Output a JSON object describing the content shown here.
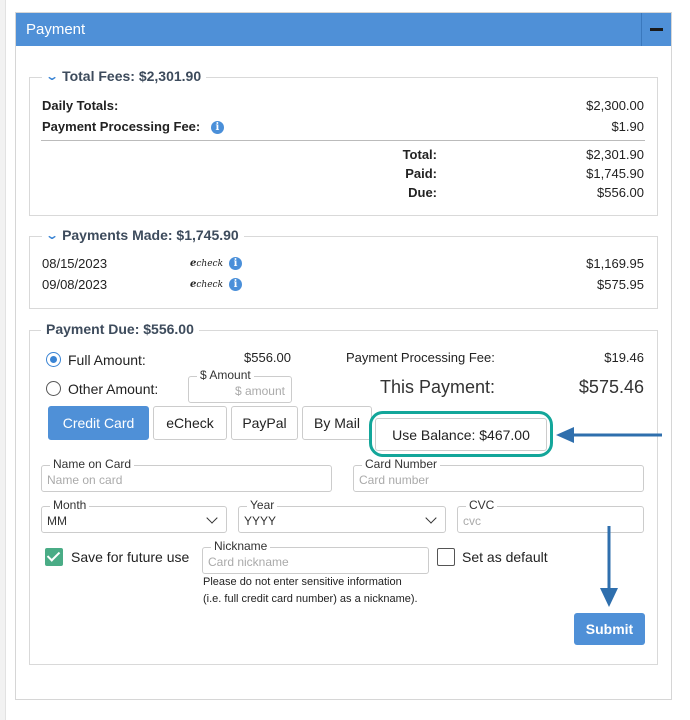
{
  "panel": {
    "title": "Payment"
  },
  "total_fees": {
    "heading": "Total Fees: $2,301.90",
    "daily_totals_label": "Daily Totals:",
    "daily_totals_value": "$2,300.00",
    "processing_fee_label": "Payment Processing Fee:",
    "processing_fee_value": "$1.90",
    "total_label": "Total:",
    "total_value": "$2,301.90",
    "paid_label": "Paid:",
    "paid_value": "$1,745.90",
    "due_label": "Due:",
    "due_value": "$556.00"
  },
  "payments_made": {
    "heading": "Payments Made: $1,745.90",
    "items": [
      {
        "date": "08/15/2023",
        "method": "echeck",
        "amount": "$1,169.95"
      },
      {
        "date": "09/08/2023",
        "method": "echeck",
        "amount": "$575.95"
      }
    ]
  },
  "payment_due": {
    "heading": "Payment Due: $556.00",
    "full_amount_label": "Full Amount:",
    "full_amount_value": "$556.00",
    "other_amount_label": "Other Amount:",
    "amount_field_label": "$ Amount",
    "amount_field_placeholder": "$ amount",
    "fee_label": "Payment Processing Fee:",
    "fee_value": "$19.46",
    "this_payment_label": "This Payment:",
    "this_payment_value": "$575.46",
    "tabs": [
      {
        "label": "Credit Card",
        "active": true
      },
      {
        "label": "eCheck",
        "active": false
      },
      {
        "label": "PayPal",
        "active": false
      },
      {
        "label": "By Mail",
        "active": false
      },
      {
        "label": "Use Balance: $467.00",
        "active": false
      }
    ],
    "form": {
      "name_label": "Name on Card",
      "name_placeholder": "Name on card",
      "card_label": "Card Number",
      "card_placeholder": "Card number",
      "month_label": "Month",
      "month_value": "MM",
      "year_label": "Year",
      "year_value": "YYYY",
      "cvc_label": "CVC",
      "cvc_placeholder": "cvc",
      "save_label": "Save for future use",
      "save_checked": true,
      "nickname_label": "Nickname",
      "nickname_placeholder": "Card nickname",
      "nickname_note_1": "Please do not enter sensitive information",
      "nickname_note_2": "(i.e. full credit card number) as a nickname).",
      "default_label": "Set as default",
      "default_checked": false
    },
    "submit_label": "Submit"
  },
  "colors": {
    "accent": "#4f90d7",
    "highlight": "#13a69a",
    "arrow": "#2f6fad",
    "checkbox": "#4aac86"
  },
  "echeck_logo_text": "check"
}
